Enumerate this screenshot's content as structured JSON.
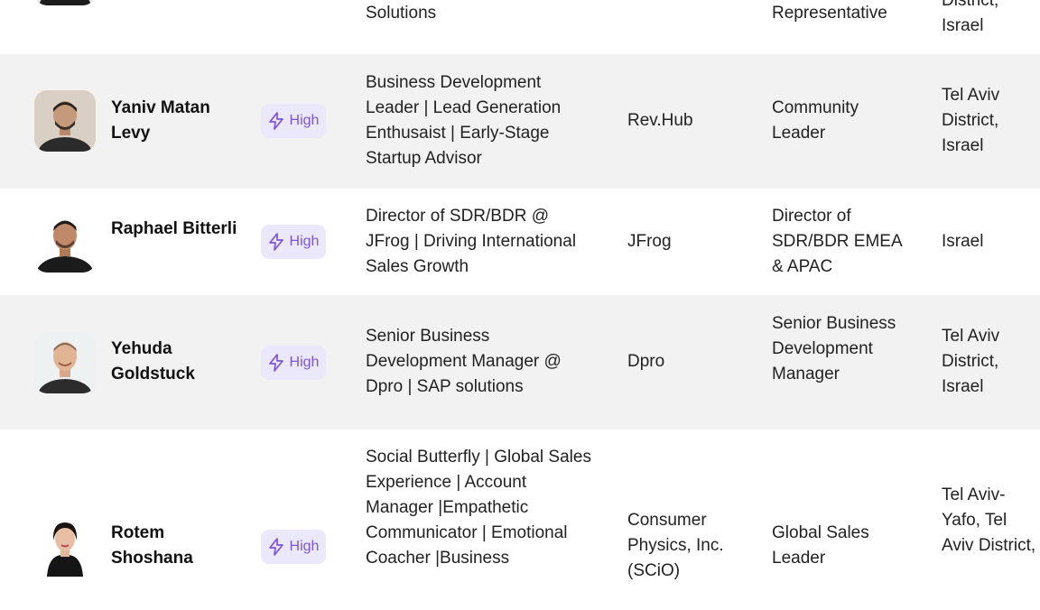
{
  "colors": {
    "row_alt_bg": "#f2f2f2",
    "badge_bg": "#ece8fb",
    "badge_fg": "#7b55d9"
  },
  "rows": [
    {
      "name": "",
      "score_label": "",
      "headline": "Solutions",
      "company": "",
      "title": "Representative",
      "location": "District, Israel"
    },
    {
      "name": "Yaniv Matan Levy",
      "score_label": "High",
      "score_icon": "lightning-icon",
      "headline": "Business Development Leader | Lead Generation Enthusaist | Early-Stage Startup Advisor",
      "company": "Rev.Hub",
      "title": "Community Leader",
      "location": "Tel Aviv District, Israel"
    },
    {
      "name": "Raphael Bitterli",
      "score_label": "High",
      "score_icon": "lightning-icon",
      "headline": "Director of SDR/BDR @ JFrog | Driving International Sales Growth",
      "company": "JFrog",
      "title": "Director of SDR/BDR EMEA & APAC",
      "location": "Israel"
    },
    {
      "name": "Yehuda Goldstuck",
      "score_label": "High",
      "score_icon": "lightning-icon",
      "headline": "Senior Business Development Manager @ Dpro | SAP solutions",
      "company": "Dpro",
      "title": "Senior Business Development Manager",
      "location": "Tel Aviv District, Israel"
    },
    {
      "name": "Rotem Shoshana",
      "score_label": "High",
      "score_icon": "lightning-icon",
      "headline": "Social Butterfly | Global Sales Experience | Account Manager |Empathetic Communicator | Emotional Coacher |Business",
      "company": "Consumer Physics, Inc. (SCiO)",
      "title": "Global Sales Leader",
      "location": "Tel Aviv-Yafo, Tel Aviv District,"
    }
  ]
}
